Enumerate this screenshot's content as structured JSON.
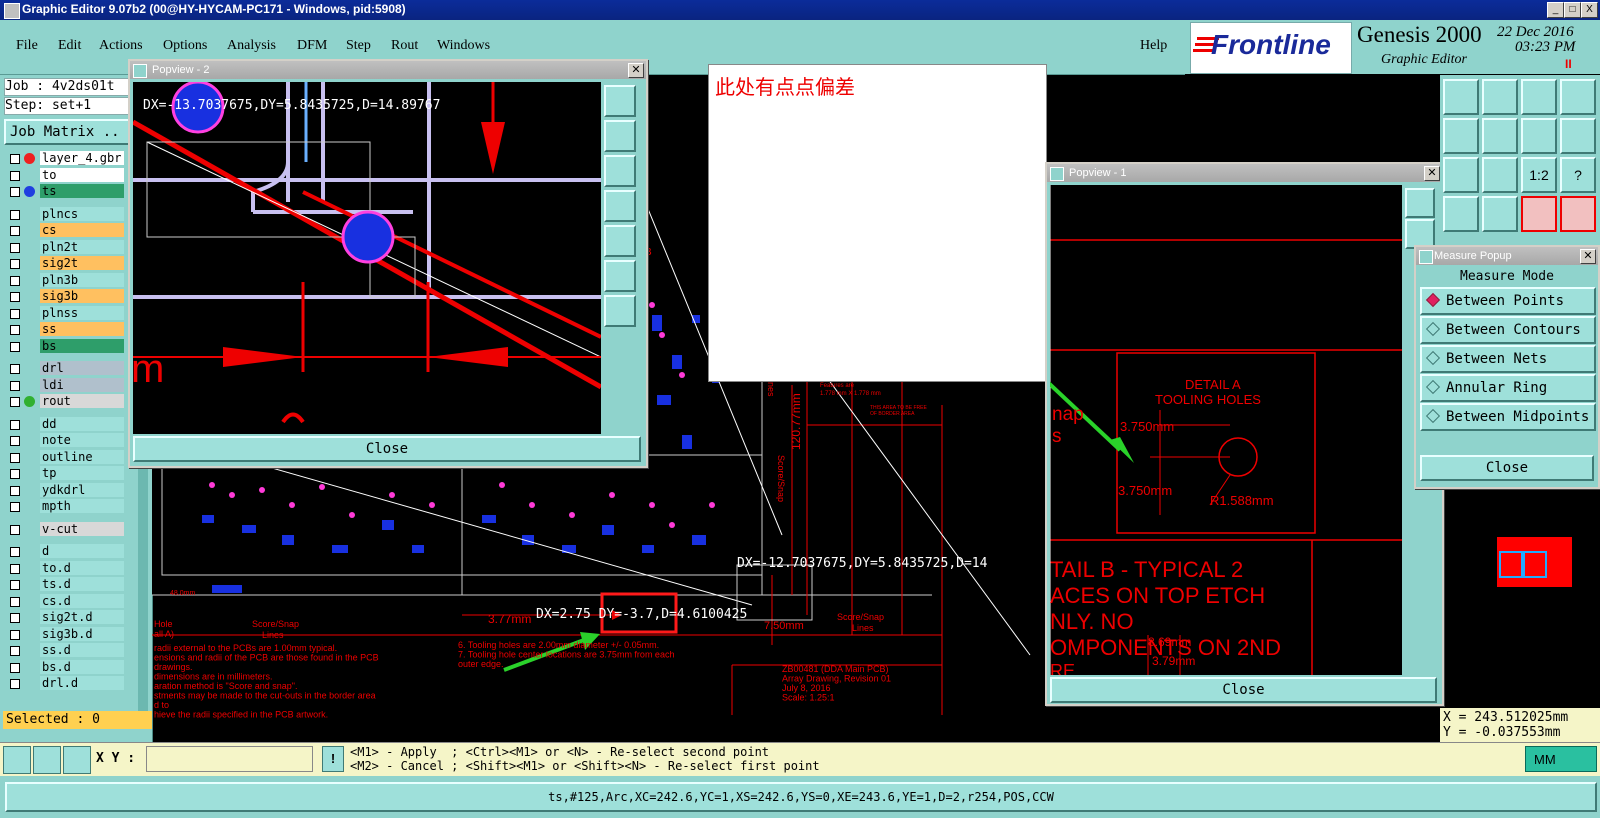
{
  "window": {
    "title": "Graphic Editor 9.07b2 (00@HY-HYCAM-PC171 - Windows, pid:5908)",
    "min": "_",
    "max": "□",
    "close": "X"
  },
  "menu": {
    "items": [
      "File",
      "Edit",
      "Actions",
      "Options",
      "Analysis",
      "DFM",
      "Step",
      "Rout",
      "Windows"
    ],
    "help": "Help"
  },
  "brand": {
    "logo": "Frontline",
    "product": "Genesis 2000",
    "subtitle": "Graphic Editor",
    "date": "22 Dec 2016",
    "time": "03:23 PM",
    "pause": "II"
  },
  "left_panel": {
    "job": "Job : 4v2ds01t",
    "step": "Step: set+1",
    "job_matrix": "Job Matrix ..",
    "layers": [
      {
        "name": "layer_4.gbr",
        "bg": "#ffffff",
        "dot": "#ee2020"
      },
      {
        "name": "to",
        "bg": "#ffffff",
        "dot": ""
      },
      {
        "name": "ts",
        "bg": "#2e9e6a",
        "dot": "#1f3fe0"
      },
      {
        "name": "plncs",
        "bg": "#9ee0da",
        "dot": ""
      },
      {
        "name": "cs",
        "bg": "#ffc060",
        "dot": ""
      },
      {
        "name": "pln2t",
        "bg": "#9ee0da",
        "dot": ""
      },
      {
        "name": "sig2t",
        "bg": "#ffc060",
        "dot": ""
      },
      {
        "name": "pln3b",
        "bg": "#9ee0da",
        "dot": ""
      },
      {
        "name": "sig3b",
        "bg": "#ffc060",
        "dot": ""
      },
      {
        "name": "plnss",
        "bg": "#9ee0da",
        "dot": ""
      },
      {
        "name": "ss",
        "bg": "#ffc060",
        "dot": ""
      },
      {
        "name": "bs",
        "bg": "#2e9e6a",
        "dot": ""
      },
      {
        "name": "drl",
        "bg": "#b0c0cc",
        "dot": ""
      },
      {
        "name": "ldi",
        "bg": "#b0c0cc",
        "dot": ""
      },
      {
        "name": "rout",
        "bg": "#d8d8d8",
        "dot": "#30b030"
      },
      {
        "name": "dd",
        "bg": "#9ee0da",
        "dot": ""
      },
      {
        "name": "note",
        "bg": "#9ee0da",
        "dot": ""
      },
      {
        "name": "outline",
        "bg": "#9ee0da",
        "dot": ""
      },
      {
        "name": "tp",
        "bg": "#9ee0da",
        "dot": ""
      },
      {
        "name": "ydkdrl",
        "bg": "#9ee0da",
        "dot": ""
      },
      {
        "name": "mpth",
        "bg": "#9ee0da",
        "dot": ""
      },
      {
        "name": "v-cut",
        "bg": "#d8d8d8",
        "dot": ""
      },
      {
        "name": "d",
        "bg": "#9ee0da",
        "dot": ""
      },
      {
        "name": "to.d",
        "bg": "#9ee0da",
        "dot": ""
      },
      {
        "name": "ts.d",
        "bg": "#9ee0da",
        "dot": ""
      },
      {
        "name": "cs.d",
        "bg": "#9ee0da",
        "dot": ""
      },
      {
        "name": "sig2t.d",
        "bg": "#9ee0da",
        "dot": ""
      },
      {
        "name": "sig3b.d",
        "bg": "#9ee0da",
        "dot": ""
      },
      {
        "name": "ss.d",
        "bg": "#9ee0da",
        "dot": ""
      },
      {
        "name": "bs.d",
        "bg": "#9ee0da",
        "dot": ""
      },
      {
        "name": "drl.d",
        "bg": "#9ee0da",
        "dot": ""
      }
    ],
    "selected": "Selected : 0"
  },
  "canvas": {
    "measure_main": "DX=2.75 DY=-3.7,D=4.6100425",
    "measure_right": "DX=-12.7037675,DY=5.8435725,D=14",
    "dims": {
      "d377": "3.77mm",
      "d750": "7.50mm",
      "d1207": "120.77mm",
      "d480": "48.0mm"
    },
    "labels": {
      "score_snap_1": "Score/Snap",
      "lines_1": "Lines",
      "score_snap_2": "Score/Snap",
      "lines_2": "Lines",
      "hole": "Hole",
      "all_a": "all A)",
      "score_snap_v": "Score/Snap",
      "lines_v": "Lines",
      "features": "Features are",
      "features2": "1.778 mm X 1.778 mm",
      "free": "THIS AREA TO BE FREE",
      "free2": "OF BORDER AREA",
      "b_mark": "B"
    },
    "notes_left": [
      "radii external to the PCBs are 1.00mm typical.",
      "ensions and radii of the PCB are those found in the PCB",
      "drawings.",
      "dimensions are in millimeters.",
      "aration method is \"Score and snap\".",
      "stments may be made to the cut-outs in the border area",
      "d to",
      "hieve the radii specified in the PCB artwork."
    ],
    "notes_mid": [
      "6. Tooling holes are 2.00mm diameter +/- 0.05mm.",
      "7. Tooling hole center locations are 3.75mm from each",
      "outer edge."
    ],
    "title_block": [
      "ZB00481 (DDA Main PCB)",
      "Array Drawing, Revision 01",
      "July 8, 2016",
      "Scale: 1.25:1"
    ]
  },
  "note_box": {
    "text": "此处有点点偏差"
  },
  "popview2": {
    "title": "Popview - 2",
    "measure": "DX=-13.7037675,DY=5.8435725,D=14.89767",
    "dim_partial": "m",
    "close": "Close"
  },
  "popview1": {
    "title": "Popview - 1",
    "detail_a": "DETAIL A",
    "tooling_holes": "TOOLING HOLES",
    "d3750_top": "3.750mm",
    "d3750_side": "3.750mm",
    "r1588": "R1.588mm",
    "snap": "nap",
    "s": "s",
    "detail_b": [
      "TAIL B - TYPICAL 2",
      "ACES ON TOP ETCH",
      "NLY.  NO",
      "OMPONENTS ON 2ND"
    ],
    "d869": "8.69mm",
    "d379": "3.79mm",
    "ore": "RE",
    "close": "Close"
  },
  "measure_popup": {
    "title": "Measure Popup",
    "mode_label": "Measure Mode",
    "modes": [
      "Between Points",
      "Between Contours",
      "Between Nets",
      "Annular Ring",
      "Between Midpoints"
    ],
    "close": "Close"
  },
  "toolbar": {
    "icons": [
      "zoom-home-icon",
      "zoom-down-icon",
      "home-icon",
      "frame-icon",
      "pan-left-icon",
      "pan-right-icon",
      "swap-icon",
      "redraw-icon",
      "fit-icon",
      "center-icon",
      "scale-icon",
      "help-icon",
      "route-icon",
      "snap-icon",
      "net-icon",
      "connect-icon"
    ],
    "scale_text": "1:2",
    "help_text": "?"
  },
  "coords": {
    "x": "X = 243.512025mm",
    "y": "Y = -0.037553mm"
  },
  "status": {
    "xy_label": "X Y :",
    "xy_value": "",
    "line1": "<M1> - Apply  ; <Ctrl><M1> or <N> - Re-select second point",
    "line2": "<M2> - Cancel ; <Shift><M1> or <Shift><N> - Re-select first point",
    "units": "MM",
    "warn": "!"
  },
  "bottom": {
    "info": "ts,#125,Arc,XC=242.6,YC=1,XS=242.6,YS=0,XE=243.6,YE=1,D=2,r254,POS,CCW"
  }
}
